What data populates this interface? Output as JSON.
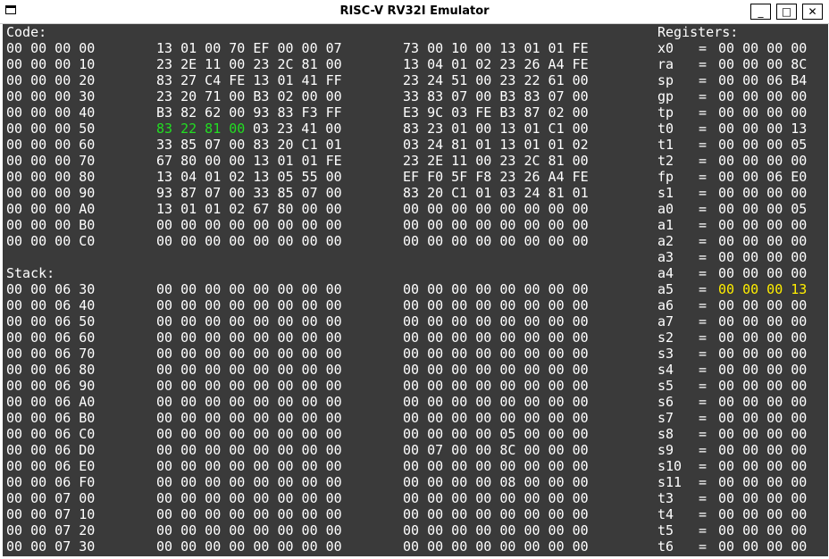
{
  "window": {
    "title": "RISC-V RV32I Emulator",
    "buttons": {
      "minimize": "_",
      "maximize": "□",
      "close": "✕"
    }
  },
  "labels": {
    "code": "Code:",
    "stack": "Stack:",
    "registers": "Registers:"
  },
  "colors": {
    "background": "#3a3a3a",
    "text": "#ffffff",
    "highlight_code": "#22dd22",
    "highlight_register": "#ffee00"
  },
  "code_rows": [
    {
      "addr": "00 00 00 00",
      "g1": "13 01 00 70 EF 00 00 07",
      "g2": "73 00 10 00 13 01 01 FE"
    },
    {
      "addr": "00 00 00 10",
      "g1": "23 2E 11 00 23 2C 81 00",
      "g2": "13 04 01 02 23 26 A4 FE"
    },
    {
      "addr": "00 00 00 20",
      "g1": "83 27 C4 FE 13 01 41 FF",
      "g2": "23 24 51 00 23 22 61 00"
    },
    {
      "addr": "00 00 00 30",
      "g1": "23 20 71 00 B3 02 00 00",
      "g2": "33 83 07 00 B3 83 07 00"
    },
    {
      "addr": "00 00 00 40",
      "g1": "B3 82 62 00 93 83 F3 FF",
      "g2": "E3 9C 03 FE B3 87 02 00"
    },
    {
      "addr": "00 00 00 50",
      "g1a": "83 22 81 00",
      "g1b": " 03 23 41 00",
      "g2": "83 23 01 00 13 01 C1 00"
    },
    {
      "addr": "00 00 00 60",
      "g1": "33 85 07 00 83 20 C1 01",
      "g2": "03 24 81 01 13 01 01 02"
    },
    {
      "addr": "00 00 00 70",
      "g1": "67 80 00 00 13 01 01 FE",
      "g2": "23 2E 11 00 23 2C 81 00"
    },
    {
      "addr": "00 00 00 80",
      "g1": "13 04 01 02 13 05 55 00",
      "g2": "EF F0 5F F8 23 26 A4 FE"
    },
    {
      "addr": "00 00 00 90",
      "g1": "93 87 07 00 33 85 07 00",
      "g2": "83 20 C1 01 03 24 81 01"
    },
    {
      "addr": "00 00 00 A0",
      "g1": "13 01 01 02 67 80 00 00",
      "g2": "00 00 00 00 00 00 00 00"
    },
    {
      "addr": "00 00 00 B0",
      "g1": "00 00 00 00 00 00 00 00",
      "g2": "00 00 00 00 00 00 00 00"
    },
    {
      "addr": "00 00 00 C0",
      "g1": "00 00 00 00 00 00 00 00",
      "g2": "00 00 00 00 00 00 00 00"
    }
  ],
  "stack_rows": [
    {
      "addr": "00 00 06 30",
      "g1": "00 00 00 00 00 00 00 00",
      "g2": "00 00 00 00 00 00 00 00"
    },
    {
      "addr": "00 00 06 40",
      "g1": "00 00 00 00 00 00 00 00",
      "g2": "00 00 00 00 00 00 00 00"
    },
    {
      "addr": "00 00 06 50",
      "g1": "00 00 00 00 00 00 00 00",
      "g2": "00 00 00 00 00 00 00 00"
    },
    {
      "addr": "00 00 06 60",
      "g1": "00 00 00 00 00 00 00 00",
      "g2": "00 00 00 00 00 00 00 00"
    },
    {
      "addr": "00 00 06 70",
      "g1": "00 00 00 00 00 00 00 00",
      "g2": "00 00 00 00 00 00 00 00"
    },
    {
      "addr": "00 00 06 80",
      "g1": "00 00 00 00 00 00 00 00",
      "g2": "00 00 00 00 00 00 00 00"
    },
    {
      "addr": "00 00 06 90",
      "g1": "00 00 00 00 00 00 00 00",
      "g2": "00 00 00 00 00 00 00 00"
    },
    {
      "addr": "00 00 06 A0",
      "g1": "00 00 00 00 00 00 00 00",
      "g2": "00 00 00 00 00 00 00 00"
    },
    {
      "addr": "00 00 06 B0",
      "g1": "00 00 00 00 00 00 00 00",
      "g2": "00 00 00 00 00 00 00 00"
    },
    {
      "addr": "00 00 06 C0",
      "g1": "00 00 00 00 00 00 00 00",
      "g2": "00 00 00 00 05 00 00 00"
    },
    {
      "addr": "00 00 06 D0",
      "g1": "00 00 00 00 00 00 00 00",
      "g2": "00 07 00 00 8C 00 00 00"
    },
    {
      "addr": "00 00 06 E0",
      "g1": "00 00 00 00 00 00 00 00",
      "g2": "00 00 00 00 00 00 00 00"
    },
    {
      "addr": "00 00 06 F0",
      "g1": "00 00 00 00 00 00 00 00",
      "g2": "00 00 00 00 08 00 00 00"
    },
    {
      "addr": "00 00 07 00",
      "g1": "00 00 00 00 00 00 00 00",
      "g2": "00 00 00 00 00 00 00 00"
    },
    {
      "addr": "00 00 07 10",
      "g1": "00 00 00 00 00 00 00 00",
      "g2": "00 00 00 00 00 00 00 00"
    },
    {
      "addr": "00 00 07 20",
      "g1": "00 00 00 00 00 00 00 00",
      "g2": "00 00 00 00 00 00 00 00"
    },
    {
      "addr": "00 00 07 30",
      "g1": "00 00 00 00 00 00 00 00",
      "g2": "00 00 00 00 00 00 00 00"
    }
  ],
  "registers": [
    {
      "name": "x0",
      "value": "00 00 00 00"
    },
    {
      "name": "ra",
      "value": "00 00 00 8C"
    },
    {
      "name": "sp",
      "value": "00 00 06 B4"
    },
    {
      "name": "gp",
      "value": "00 00 00 00"
    },
    {
      "name": "tp",
      "value": "00 00 00 00"
    },
    {
      "name": "t0",
      "value": "00 00 00 13"
    },
    {
      "name": "t1",
      "value": "00 00 00 05"
    },
    {
      "name": "t2",
      "value": "00 00 00 00"
    },
    {
      "name": "fp",
      "value": "00 00 06 E0"
    },
    {
      "name": "s1",
      "value": "00 00 00 00"
    },
    {
      "name": "a0",
      "value": "00 00 00 05"
    },
    {
      "name": "a1",
      "value": "00 00 00 00"
    },
    {
      "name": "a2",
      "value": "00 00 00 00"
    },
    {
      "name": "a3",
      "value": "00 00 00 00"
    },
    {
      "name": "a4",
      "value": "00 00 00 00"
    },
    {
      "name": "a5",
      "value": "00 00 00 13",
      "highlight": true
    },
    {
      "name": "a6",
      "value": "00 00 00 00"
    },
    {
      "name": "a7",
      "value": "00 00 00 00"
    },
    {
      "name": "s2",
      "value": "00 00 00 00"
    },
    {
      "name": "s3",
      "value": "00 00 00 00"
    },
    {
      "name": "s4",
      "value": "00 00 00 00"
    },
    {
      "name": "s5",
      "value": "00 00 00 00"
    },
    {
      "name": "s6",
      "value": "00 00 00 00"
    },
    {
      "name": "s7",
      "value": "00 00 00 00"
    },
    {
      "name": "s8",
      "value": "00 00 00 00"
    },
    {
      "name": "s9",
      "value": "00 00 00 00"
    },
    {
      "name": "s10",
      "value": "00 00 00 00"
    },
    {
      "name": "s11",
      "value": "00 00 00 00"
    },
    {
      "name": "t3",
      "value": "00 00 00 00"
    },
    {
      "name": "t4",
      "value": "00 00 00 00"
    },
    {
      "name": "t5",
      "value": "00 00 00 00"
    },
    {
      "name": "t6",
      "value": "00 00 00 00"
    }
  ]
}
